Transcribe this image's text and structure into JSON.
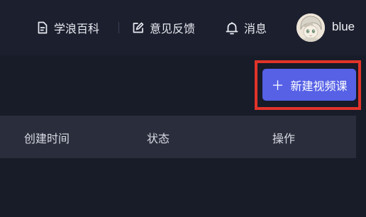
{
  "header": {
    "nav": [
      {
        "label": "学浪百科",
        "icon": "document-icon"
      },
      {
        "label": "意见反馈",
        "icon": "edit-icon"
      },
      {
        "label": "消息",
        "icon": "bell-icon"
      }
    ],
    "user": {
      "name": "blue",
      "avatar": "anime-avatar"
    }
  },
  "toolbar": {
    "new_button_label": "新建视频课",
    "new_button_icon": "plus-icon"
  },
  "table": {
    "columns": [
      "创建时间",
      "状态",
      "操作"
    ]
  },
  "colors": {
    "page_background": "#181b28",
    "header_background": "#1c1f2e",
    "primary_button": "#5661e6",
    "highlight_border": "#e1342a",
    "table_header_background": "#2a2d3c"
  }
}
